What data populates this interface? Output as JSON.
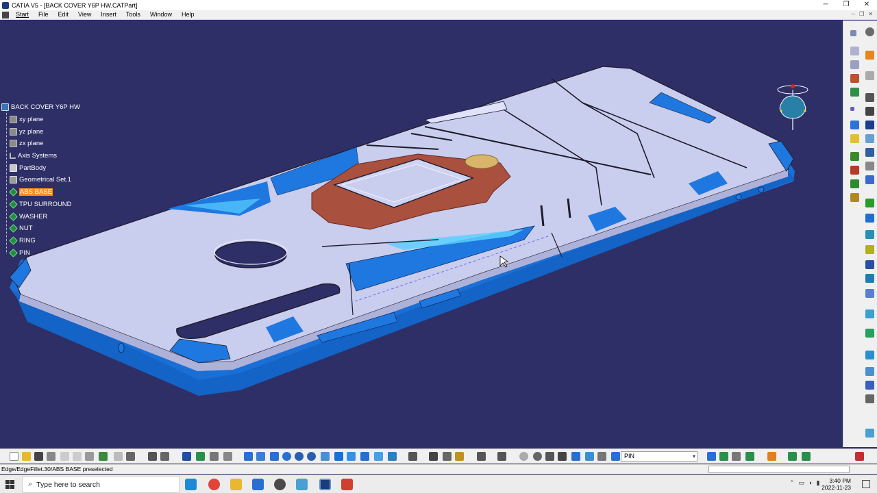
{
  "window": {
    "title": "CATIA V5 - [BACK COVER Y6P HW.CATPart]",
    "controls": [
      "─",
      "❐",
      "✕"
    ]
  },
  "menu": {
    "items": [
      "Start",
      "File",
      "Edit",
      "View",
      "Insert",
      "Tools",
      "Window",
      "Help"
    ],
    "mdi_controls": [
      "─",
      "❐",
      "✕"
    ]
  },
  "tree": {
    "root": "BACK COVER Y6P HW",
    "nodes": [
      {
        "label": "xy plane",
        "icon": "plane-icon"
      },
      {
        "label": "yz plane",
        "icon": "plane-icon"
      },
      {
        "label": "zx plane",
        "icon": "plane-icon"
      },
      {
        "label": "Axis Systems",
        "icon": "axis-system-icon"
      },
      {
        "label": "PartBody",
        "icon": "partbody-icon"
      },
      {
        "label": "Geometrical Set.1",
        "icon": "geometrical-set-icon"
      },
      {
        "label": "ABS BASE",
        "icon": "body-icon",
        "selected": true
      },
      {
        "label": "TPU SURROUND",
        "icon": "body-icon"
      },
      {
        "label": "WASHER",
        "icon": "body-icon"
      },
      {
        "label": "NUT",
        "icon": "body-icon"
      },
      {
        "label": "RING",
        "icon": "body-icon"
      },
      {
        "label": "PIN",
        "icon": "body-icon"
      }
    ]
  },
  "colors": {
    "background": "#2e2f66",
    "part_surface": "#c8cdee",
    "part_blue": "#1f78e0",
    "washer": "#a9503e",
    "nut": "#d8b56a",
    "highlight": "#ff8c1a"
  },
  "toolbar": {
    "layer_combo": "PIN"
  },
  "status": {
    "message": "Edge/EdgeFillet.30/ABS BASE preselected"
  },
  "taskbar": {
    "search_placeholder": "Type here to search",
    "time": "3:40 PM",
    "date": "2022-11-23"
  }
}
